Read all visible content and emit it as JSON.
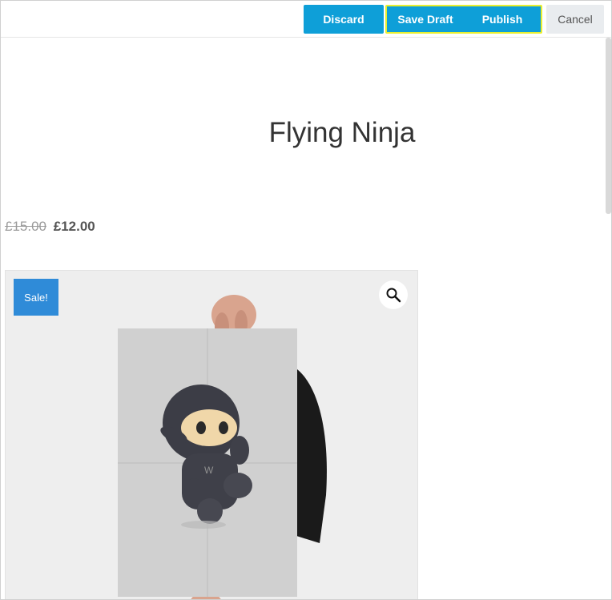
{
  "toolbar": {
    "discard_label": "Discard",
    "save_draft_label": "Save Draft",
    "publish_label": "Publish",
    "cancel_label": "Cancel"
  },
  "product": {
    "title": "Flying Ninja",
    "old_price": "£15.00",
    "new_price": "£12.00",
    "sale_badge": "Sale!",
    "zoom_icon": "search-icon",
    "image_icon": "ninja-poster-image"
  },
  "colors": {
    "primary": "#0e9fd8",
    "highlight": "#e9ef2f",
    "badge": "#2f8bd8"
  }
}
